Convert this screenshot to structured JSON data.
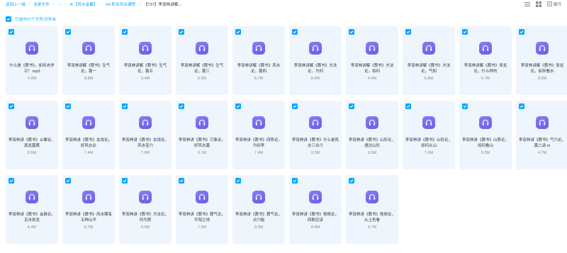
{
  "breadcrumb": {
    "back": "返回上一级",
    "all_files": "全部文件",
    "ellipsis": "...",
    "level1": "A-【风水金囊】",
    "level2": "04-职业风水课程",
    "current": "【737】李双林讲解..."
  },
  "toolbar": {
    "expand_label": "展开"
  },
  "selection": {
    "text": "已选中27个文件/文件夹"
  },
  "colors": {
    "accent": "#06a7ff",
    "card_bg": "#eef5fd",
    "audio_icon": "#7b6cf0"
  },
  "file_icon": "headphones-icon",
  "files": [
    {
      "name": "什么是《葬书》，如何去学习？.mp3",
      "size": "4.9M"
    },
    {
      "name": "李双林讲解《葬书》生气论，篇一",
      "size": "8.8M"
    },
    {
      "name": "李双林讲解《葬书》生气论，篇五",
      "size": "9.4M"
    },
    {
      "name": "李双林讲解《葬书》生气论，篇三",
      "size": "6.9M"
    },
    {
      "name": "李双林讲解《葬书》风水论，篇四",
      "size": "8.7M"
    },
    {
      "name": "李双林讲解《葬书》方法论，为何",
      "size": "8.9M"
    },
    {
      "name": "李双林讲解《葬书》方法论，如何",
      "size": "9.4M"
    },
    {
      "name": "李双林讲解《葬书》方法论，气知",
      "size": "6.8M"
    },
    {
      "name": "李双林讲解《葬书》来龙论，什么样的",
      "size": "6.7M"
    },
    {
      "name": "李双林讲解《葬书》来龙论，如何看水",
      "size": "8.5M"
    },
    {
      "name": "李双林讲《葬书》止聚论，真龙墓葬",
      "size": "8.5M"
    },
    {
      "name": "李双林讲《葬书》支垅论，好风水必",
      "size": "7.4M"
    },
    {
      "name": "李双林讲《葬书》支垅论，风水宝穴",
      "size": "7.6M"
    },
    {
      "name": "李双林讲《葬书》万象论，好风水墓",
      "size": "9.1M"
    },
    {
      "name": "李双林讲《葬书》四势论，为何李",
      "size": "7.4M"
    },
    {
      "name": "李双林讲《葬书》什么是风水三合六",
      "size": "9.2M"
    },
    {
      "name": "李双林讲《葬书》山形论，遇过山形",
      "size": "9.5M"
    },
    {
      "name": "李双林讲《葬书》山形论，如何从山",
      "size": "7.6M"
    },
    {
      "name": "李双林讲《葬书》山势论，如何看山",
      "size": "9.2M"
    },
    {
      "name": "李双林讲《葬书》气穴论，篇二讲.m",
      "size": "4.7M"
    },
    {
      "name": "李双林讲《葬书》会脉论，见水则龙",
      "size": "6.4M"
    },
    {
      "name": "李双林讲《葬书》风水哪有五种山不",
      "size": "8.7M"
    },
    {
      "name": "李双林讲《葬书》方法论，何为阴",
      "size": "9.5M"
    },
    {
      "name": "李双林讲《葬书》葬气论，平阳之地",
      "size": "7.5M"
    },
    {
      "name": "李双林讲《葬书》葬气论，点穴秘",
      "size": "9.3M"
    },
    {
      "name": "李双林讲《葬书》败绝论，四败应该",
      "size": "8.8M"
    },
    {
      "name": "李双林讲《葬书》败绝论，从土色看",
      "size": "8.7M"
    }
  ]
}
